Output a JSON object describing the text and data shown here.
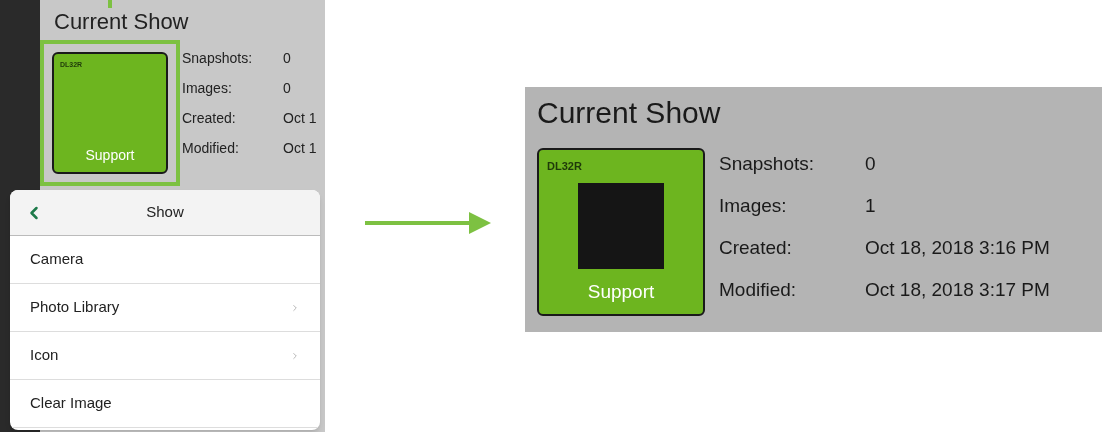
{
  "before": {
    "title": "Current Show",
    "tile": {
      "model": "DL32R",
      "label": "Support",
      "has_image": false,
      "highlighted": true
    },
    "info": [
      {
        "label": "Snapshots:",
        "value": "0"
      },
      {
        "label": "Images:",
        "value": "0"
      },
      {
        "label": "Created:",
        "value": "Oct 1"
      },
      {
        "label": "Modified:",
        "value": "Oct 1"
      }
    ],
    "popover": {
      "title": "Show",
      "items": [
        {
          "label": "Camera",
          "has_submenu": false
        },
        {
          "label": "Photo Library",
          "has_submenu": true
        },
        {
          "label": "Icon",
          "has_submenu": true
        },
        {
          "label": "Clear Image",
          "has_submenu": false
        }
      ]
    }
  },
  "after": {
    "title": "Current Show",
    "tile": {
      "model": "DL32R",
      "label": "Support",
      "has_image": true,
      "highlighted": false
    },
    "info": [
      {
        "label": "Snapshots:",
        "value": "0"
      },
      {
        "label": "Images:",
        "value": "1"
      },
      {
        "label": "Created:",
        "value": "Oct 18, 2018 3:16 PM"
      },
      {
        "label": "Modified:",
        "value": "Oct 18, 2018 3:17 PM"
      }
    ]
  }
}
